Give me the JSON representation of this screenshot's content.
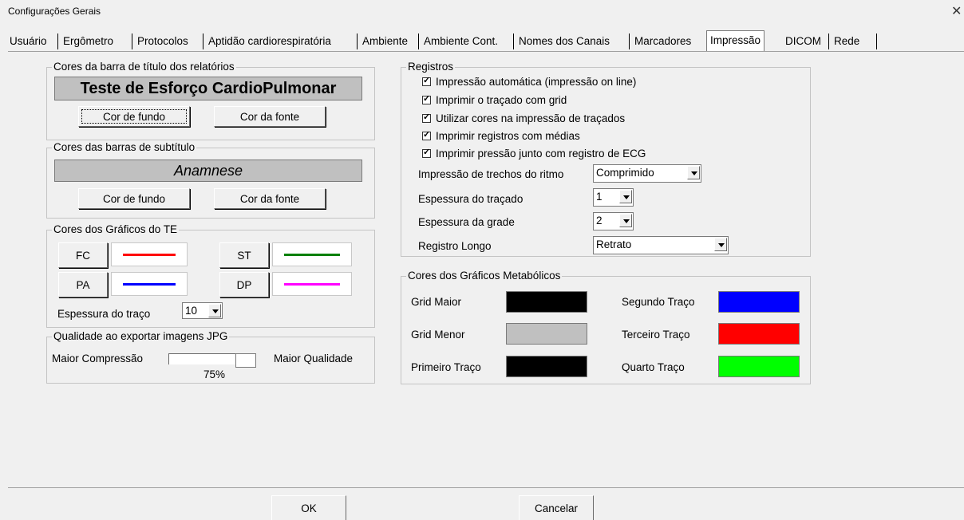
{
  "window": {
    "title": "Configurações Gerais",
    "close": "✕"
  },
  "tabs": [
    "Usuário",
    "Ergômetro",
    "Protocolos",
    "Aptidão cardiorespiratória",
    "Ambiente",
    "Ambiente Cont.",
    "Nomes dos Canais",
    "Marcadores",
    "Impressão",
    "DICOM",
    "Rede"
  ],
  "active_tab": "Impressão",
  "titlebar_colors": {
    "legend": "Cores da barra de título dos relatórios",
    "preview": "Teste de Esforço CardioPulmonar",
    "bg_button": "Cor de fundo",
    "font_button": "Cor da fonte"
  },
  "subtitle_colors": {
    "legend": "Cores das  barras de subtítulo",
    "preview": "Anamnese",
    "bg_button": "Cor de fundo",
    "font_button": "Cor da fonte"
  },
  "te_graphs": {
    "legend": "Cores dos Gráficos do TE",
    "items": [
      {
        "label": "FC",
        "color": "#ff0000"
      },
      {
        "label": "ST",
        "color": "#008000"
      },
      {
        "label": "PA",
        "color": "#0000ff"
      },
      {
        "label": "DP",
        "color": "#ff00ff"
      }
    ],
    "thickness_label": "Espessura do traço",
    "thickness_value": "10"
  },
  "jpg_quality": {
    "legend": "Qualidade ao exportar imagens JPG",
    "min_label": "Maior Compressão",
    "max_label": "Maior Qualidade",
    "value": "75%",
    "fraction": 0.75
  },
  "registros": {
    "legend": "Registros",
    "checks": [
      "Impressão automática  (impressão on line)",
      "Imprimir o traçado com grid",
      "Utilizar cores na impressão de traçados",
      "Imprimir registros com médias",
      "Imprimir pressão junto com registro de ECG"
    ],
    "ritmo_label": "Impressão de trechos do ritmo",
    "ritmo_value": "Comprimido",
    "tracado_label": "Espessura do traçado",
    "tracado_value": "1",
    "grade_label": "Espessura da grade",
    "grade_value": "2",
    "longo_label": "Registro Longo",
    "longo_value": "Retrato"
  },
  "metabolic": {
    "legend": "Cores dos Gráficos Metabólicos",
    "left": [
      {
        "label": "Grid Maior",
        "color": "#000000"
      },
      {
        "label": "Grid Menor",
        "color": "#c0c0c0"
      },
      {
        "label": "Primeiro Traço",
        "color": "#000000"
      }
    ],
    "right": [
      {
        "label": "Segundo Traço",
        "color": "#0000ff"
      },
      {
        "label": "Terceiro Traço",
        "color": "#ff0000"
      },
      {
        "label": "Quarto Traço",
        "color": "#00ff00"
      }
    ]
  },
  "footer": {
    "ok": "OK",
    "cancel": "Cancelar"
  }
}
